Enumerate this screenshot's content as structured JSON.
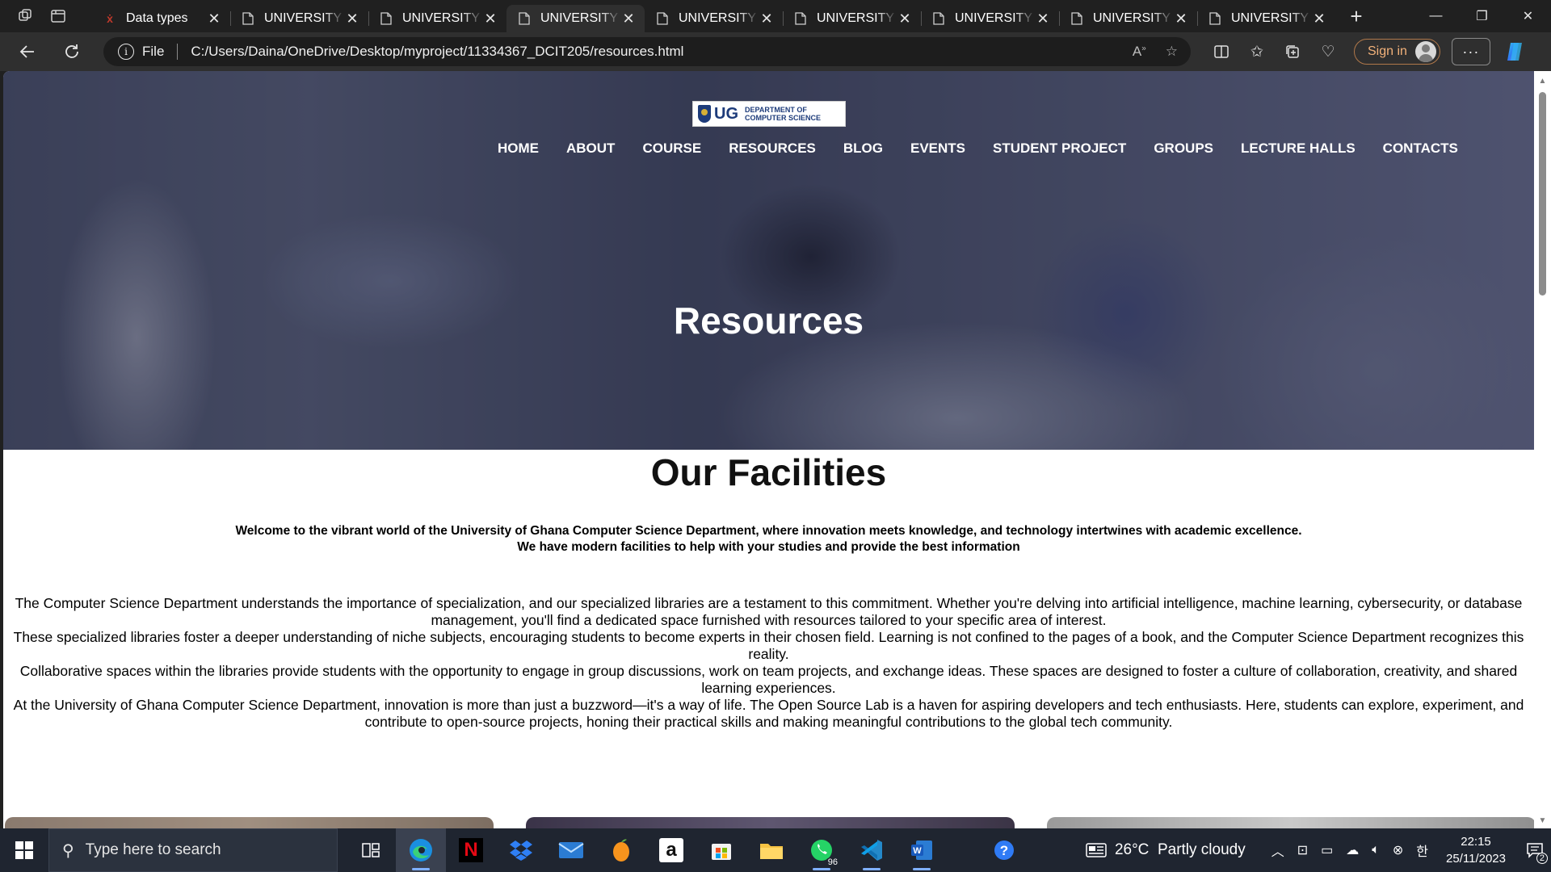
{
  "browser": {
    "tabs": [
      {
        "title": "Data types",
        "active": false,
        "favicon": "red-x-favicon"
      },
      {
        "title": "UNIVERSITY OF GHANA",
        "active": false,
        "favicon": "page-icon"
      },
      {
        "title": "UNIVERSITY OF GHANA",
        "active": false,
        "favicon": "page-icon"
      },
      {
        "title": "UNIVERSITY OF GHANA",
        "active": true,
        "favicon": "page-icon"
      },
      {
        "title": "UNIVERSITY OF GHANA",
        "active": false,
        "favicon": "page-icon"
      },
      {
        "title": "UNIVERSITY OF GHANA",
        "active": false,
        "favicon": "page-icon"
      },
      {
        "title": "UNIVERSITY OF GHANA",
        "active": false,
        "favicon": "page-icon"
      },
      {
        "title": "UNIVERSITY OF GHANA",
        "active": false,
        "favicon": "page-icon"
      },
      {
        "title": "UNIVERSITY OF GHANA",
        "active": false,
        "favicon": "page-icon"
      }
    ],
    "file_label": "File",
    "url": "C:/Users/Daina/OneDrive/Desktop/myproject/11334367_DCIT205/resources.html",
    "sign_in_label": "Sign in",
    "more_label": "···"
  },
  "page": {
    "logo": {
      "ug": "UG",
      "line1": "DEPARTMENT OF",
      "line2": "COMPUTER SCIENCE"
    },
    "nav": [
      "HOME",
      "ABOUT",
      "COURSE",
      "RESOURCES",
      "BLOG",
      "EVENTS",
      "STUDENT PROJECT",
      "GROUPS",
      "LECTURE HALLS",
      "CONTACTS"
    ],
    "hero_title": "Resources",
    "section_title": "Our Facilities",
    "intro_lines": [
      "Welcome to the vibrant world of the University of Ghana Computer Science Department, where innovation meets knowledge, and technology intertwines with academic excellence.",
      "We have modern facilities to help with your studies and provide the best information"
    ],
    "paragraphs": [
      "The Computer Science Department understands the importance of specialization, and our specialized libraries are a testament to this commitment. Whether you're delving into artificial intelligence, machine learning, cybersecurity, or database management, you'll find a dedicated space furnished with resources tailored to your specific area of interest.",
      "These specialized libraries foster a deeper understanding of niche subjects, encouraging students to become experts in their chosen field. Learning is not confined to the pages of a book, and the Computer Science Department recognizes this reality.",
      "Collaborative spaces within the libraries provide students with the opportunity to engage in group discussions, work on team projects, and exchange ideas. These spaces are designed to foster a culture of collaboration, creativity, and shared learning experiences.",
      "At the University of Ghana Computer Science Department, innovation is more than just a buzzword—it's a way of life. The Open Source Lab is a haven for aspiring developers and tech enthusiasts. Here, students can explore, experiment, and contribute to open-source projects, honing their practical skills and making meaningful contributions to the global tech community."
    ]
  },
  "taskbar": {
    "search_placeholder": "Type here to search",
    "apps": [
      {
        "name": "task-view",
        "active": false,
        "open": false
      },
      {
        "name": "edge",
        "active": true,
        "open": true
      },
      {
        "name": "netflix",
        "active": false,
        "open": false
      },
      {
        "name": "dropbox",
        "active": false,
        "open": false
      },
      {
        "name": "mail",
        "active": false,
        "open": false
      },
      {
        "name": "fl-studio",
        "active": false,
        "open": false
      },
      {
        "name": "amazon",
        "active": false,
        "open": false
      },
      {
        "name": "microsoft-store",
        "active": false,
        "open": false
      },
      {
        "name": "file-explorer",
        "active": false,
        "open": false
      },
      {
        "name": "whatsapp",
        "active": false,
        "open": true,
        "badge": "96"
      },
      {
        "name": "vscode",
        "active": false,
        "open": true
      },
      {
        "name": "word",
        "active": false,
        "open": true
      },
      {
        "name": "help",
        "active": false,
        "open": false
      }
    ],
    "weather_text": "26°C  Partly cloudy",
    "time": "22:15",
    "date": "25/11/2023",
    "notification_count": "2"
  }
}
